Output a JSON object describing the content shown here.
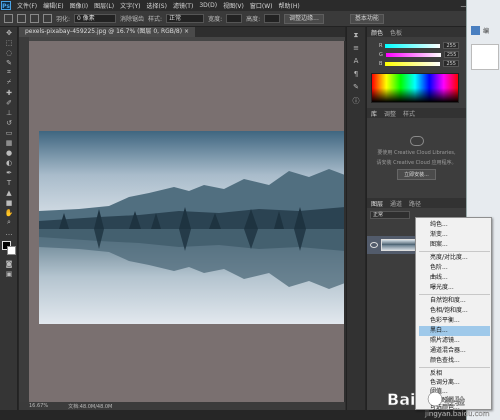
{
  "menubar": {
    "logo": "Ps",
    "items": [
      "文件(F)",
      "编辑(E)",
      "图像(I)",
      "图层(L)",
      "文字(Y)",
      "选择(S)",
      "滤镜(T)",
      "3D(D)",
      "视图(V)",
      "窗口(W)",
      "帮助(H)"
    ],
    "minimize": "—",
    "maximize": "□",
    "close": "✕"
  },
  "options": {
    "feather_label": "羽化:",
    "feather_value": "0 像素",
    "antialias_label": "消除锯齿",
    "style_label": "样式:",
    "style_value": "正常",
    "width_label": "宽度:",
    "height_label": "高度:",
    "refine_edge": "调整边缘...",
    "workspace": "基本功能"
  },
  "document": {
    "tab_title": "pexels-pixabay-459225.jpg @ 16.7% (图层 0, RGB/8) ×"
  },
  "statusbar": {
    "zoom": "16.67%",
    "doc_size": "文档:48.0M/48.0M"
  },
  "color_panel": {
    "tabs": [
      "颜色",
      "色板"
    ],
    "channels": [
      {
        "label": "R",
        "value": "255",
        "color": "#e05050"
      },
      {
        "label": "G",
        "value": "255",
        "color": "#e050e0"
      },
      {
        "label": "B",
        "value": "255",
        "color": "#f0e020"
      }
    ]
  },
  "libraries_panel": {
    "tabs": [
      "库",
      "调整",
      "样式"
    ],
    "message_line1": "要使用 Creative Cloud Libraries,",
    "message_line2": "请安装 Creative Cloud 应用程序。",
    "button": "立即安装..."
  },
  "layers_panel": {
    "tabs": [
      "图层",
      "通道",
      "路径"
    ],
    "blend_mode": "正常",
    "layer_name": ""
  },
  "context_menu": {
    "items": [
      {
        "label": "纯色..."
      },
      {
        "label": "渐变..."
      },
      {
        "label": "图案..."
      },
      {
        "label": "亮度/对比度..."
      },
      {
        "label": "色阶..."
      },
      {
        "label": "曲线..."
      },
      {
        "label": "曝光度..."
      },
      {
        "label": "自然饱和度..."
      },
      {
        "label": "色相/饱和度..."
      },
      {
        "label": "色彩平衡..."
      },
      {
        "label": "黑白...",
        "highlighted": true
      },
      {
        "label": "照片滤镜..."
      },
      {
        "label": "通道混合器..."
      },
      {
        "label": "颜色查找..."
      },
      {
        "label": "反相"
      },
      {
        "label": "色调分离..."
      },
      {
        "label": "阈值..."
      },
      {
        "label": "渐变映射..."
      },
      {
        "label": "可选颜色..."
      }
    ]
  },
  "watermark": {
    "brand": "Bai",
    "brand_suffix": "经验",
    "url": "jingyan.baidu.com"
  },
  "taskbar_window": {
    "label": "编"
  }
}
